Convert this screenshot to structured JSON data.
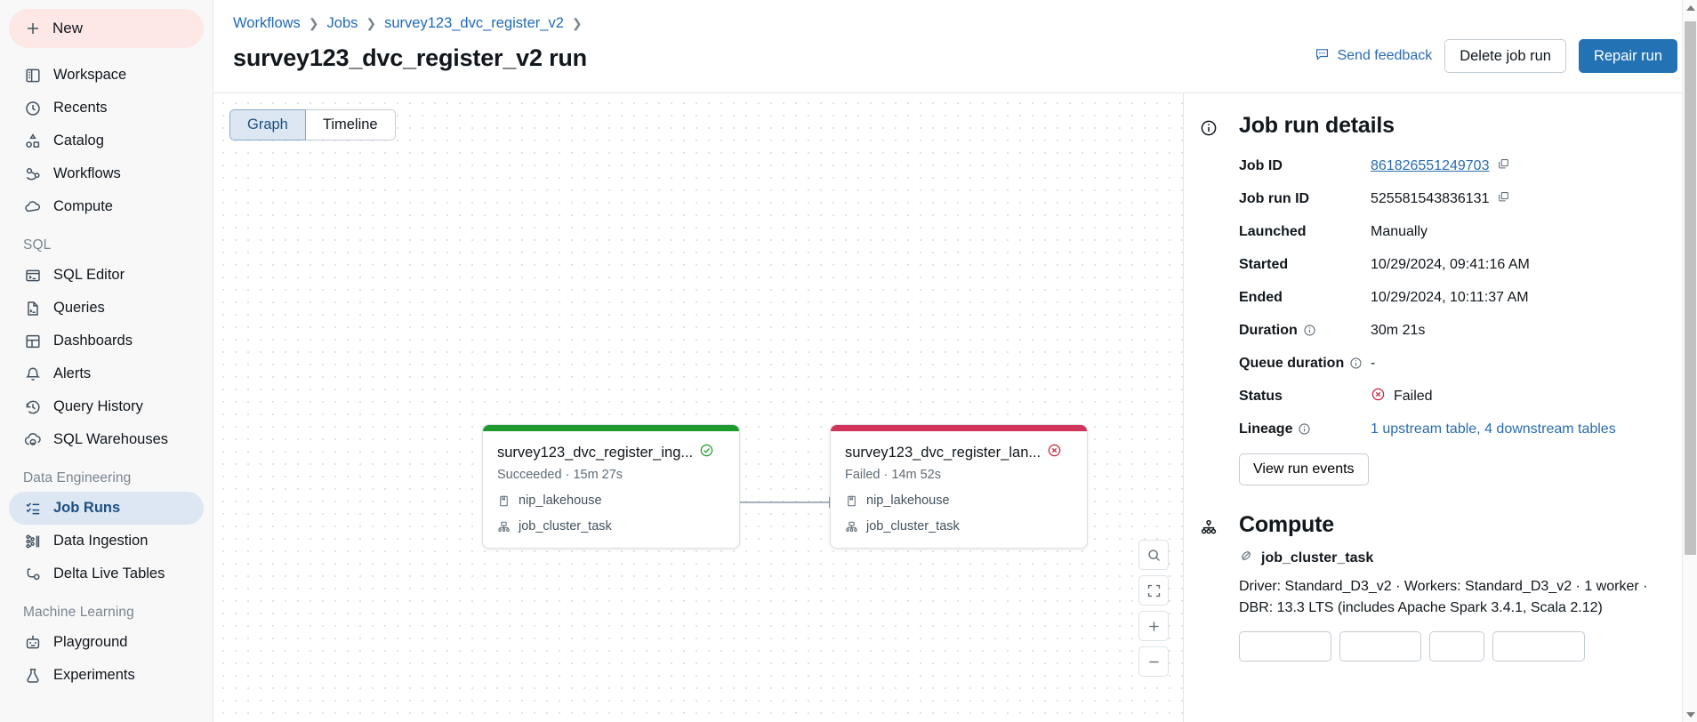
{
  "sidebar": {
    "new_label": "New",
    "groups": [
      {
        "header": "",
        "items": [
          {
            "label": "Workspace",
            "icon": "workspace-icon",
            "active": false
          },
          {
            "label": "Recents",
            "icon": "clock-icon",
            "active": false
          },
          {
            "label": "Catalog",
            "icon": "catalog-icon",
            "active": false
          },
          {
            "label": "Workflows",
            "icon": "workflows-icon",
            "active": false
          },
          {
            "label": "Compute",
            "icon": "cloud-icon",
            "active": false
          }
        ]
      },
      {
        "header": "SQL",
        "items": [
          {
            "label": "SQL Editor",
            "icon": "sql-editor-icon",
            "active": false
          },
          {
            "label": "Queries",
            "icon": "queries-icon",
            "active": false
          },
          {
            "label": "Dashboards",
            "icon": "dashboards-icon",
            "active": false
          },
          {
            "label": "Alerts",
            "icon": "bell-icon",
            "active": false
          },
          {
            "label": "Query History",
            "icon": "history-icon",
            "active": false
          },
          {
            "label": "SQL Warehouses",
            "icon": "warehouse-icon",
            "active": false
          }
        ]
      },
      {
        "header": "Data Engineering",
        "items": [
          {
            "label": "Job Runs",
            "icon": "job-runs-icon",
            "active": true
          },
          {
            "label": "Data Ingestion",
            "icon": "data-ingestion-icon",
            "active": false
          },
          {
            "label": "Delta Live Tables",
            "icon": "delta-live-tables-icon",
            "active": false
          }
        ]
      },
      {
        "header": "Machine Learning",
        "items": [
          {
            "label": "Playground",
            "icon": "robot-icon",
            "active": false
          },
          {
            "label": "Experiments",
            "icon": "experiments-icon",
            "active": false
          }
        ]
      }
    ]
  },
  "header": {
    "breadcrumbs": [
      "Workflows",
      "Jobs",
      "survey123_dvc_register_v2"
    ],
    "title": "survey123_dvc_register_v2 run",
    "feedback_label": "Send feedback",
    "delete_label": "Delete job run",
    "repair_label": "Repair run"
  },
  "graph": {
    "tabs": [
      {
        "label": "Graph",
        "active": true
      },
      {
        "label": "Timeline",
        "active": false
      }
    ],
    "nodes": [
      {
        "title": "survey123_dvc_register_ing...",
        "status": "Succeeded",
        "duration": "15m 27s",
        "status_text": "Succeeded  ·  15m 27s",
        "catalog": "nip_lakehouse",
        "cluster": "job_cluster_task",
        "bar_color": "#1f9b2e",
        "state": "success"
      },
      {
        "title": "survey123_dvc_register_lan...",
        "status": "Failed",
        "duration": "14m 52s",
        "status_text": "Failed  ·  14m 52s",
        "catalog": "nip_lakehouse",
        "cluster": "job_cluster_task",
        "bar_color": "#d1345b",
        "state": "failed"
      }
    ],
    "controls": [
      "search-icon",
      "fit-screen-icon",
      "zoom-in-icon",
      "zoom-out-icon"
    ]
  },
  "details": {
    "title": "Job run details",
    "rows": [
      {
        "label": "Job ID",
        "value": "861826551249703",
        "link": true,
        "copy": true,
        "info": false
      },
      {
        "label": "Job run ID",
        "value": "525581543836131",
        "link": false,
        "copy": true,
        "info": false
      },
      {
        "label": "Launched",
        "value": "Manually",
        "link": false,
        "copy": false,
        "info": false
      },
      {
        "label": "Started",
        "value": "10/29/2024, 09:41:16 AM",
        "link": false,
        "copy": false,
        "info": false
      },
      {
        "label": "Ended",
        "value": "10/29/2024, 10:11:37 AM",
        "link": false,
        "copy": false,
        "info": false
      },
      {
        "label": "Duration",
        "value": "30m 21s",
        "link": false,
        "copy": false,
        "info": true
      },
      {
        "label": "Queue duration",
        "value": "-",
        "link": false,
        "copy": false,
        "info": true
      },
      {
        "label": "Status",
        "value": "Failed",
        "link": false,
        "copy": false,
        "info": false,
        "status": true
      },
      {
        "label": "Lineage",
        "value": "1 upstream table, 4 downstream tables",
        "link": true,
        "copy": false,
        "info": true
      }
    ],
    "view_events_label": "View run events"
  },
  "compute": {
    "title": "Compute",
    "cluster_name": "job_cluster_task",
    "description_line1": "Driver: Standard_D3_v2 · Workers: Standard_D3_v2 · 1 worker ·",
    "description_line2": "DBR: 13.3 LTS (includes Apache Spark 3.4.1, Scala 2.12)"
  },
  "colors": {
    "accent": "#2272b4",
    "success": "#1f9b2e",
    "failure": "#d1345b",
    "link": "#2a6cb0"
  }
}
